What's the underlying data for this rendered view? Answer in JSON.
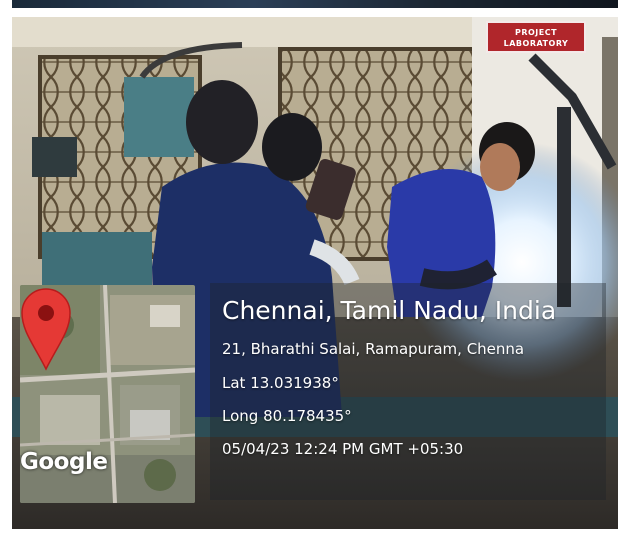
{
  "sign": {
    "line1": "PROJECT",
    "line2": "LABORATORY"
  },
  "location": {
    "title": "Chennai, Tamil Nadu, India",
    "address": "21, Bharathi Salai, Ramapuram, Chenna",
    "lat": "Lat 13.031938°",
    "long": "Long 80.178435°",
    "datetime": "05/04/23 12:24 PM GMT +05:30"
  },
  "map": {
    "brand": "Google",
    "pin_icon": "map-pin-icon",
    "pin_color": "#e53935"
  },
  "colors": {
    "overlay_text": "#ffffff",
    "sign_red": "#b0262b",
    "weld_glow": "#e8f4ff"
  }
}
